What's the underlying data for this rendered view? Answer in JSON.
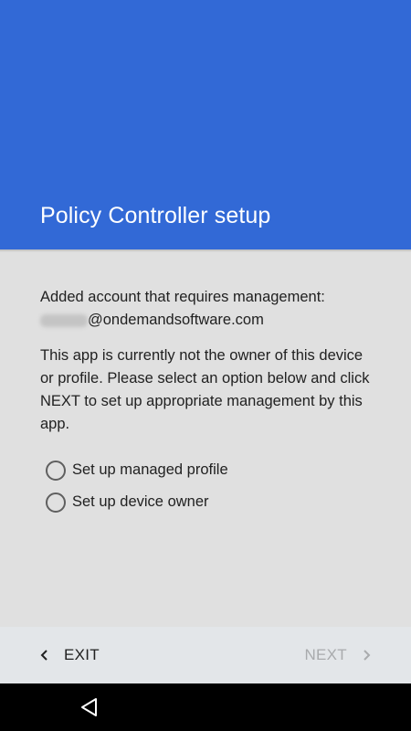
{
  "header": {
    "title": "Policy Controller setup",
    "color": "#3269d6"
  },
  "content": {
    "account_line": "Added account that requires management:",
    "email_domain": "@ondemandsoftware.com",
    "description": "This app is currently not the owner of this device or profile. Please select an option below and click NEXT to set up appropriate management by this app."
  },
  "options": [
    {
      "label": "Set up managed profile",
      "selected": false
    },
    {
      "label": "Set up device owner",
      "selected": false
    }
  ],
  "footer": {
    "exit_label": "EXIT",
    "next_label": "NEXT",
    "next_enabled": false
  },
  "system_nav": {
    "back_icon": "back-triangle-icon"
  }
}
